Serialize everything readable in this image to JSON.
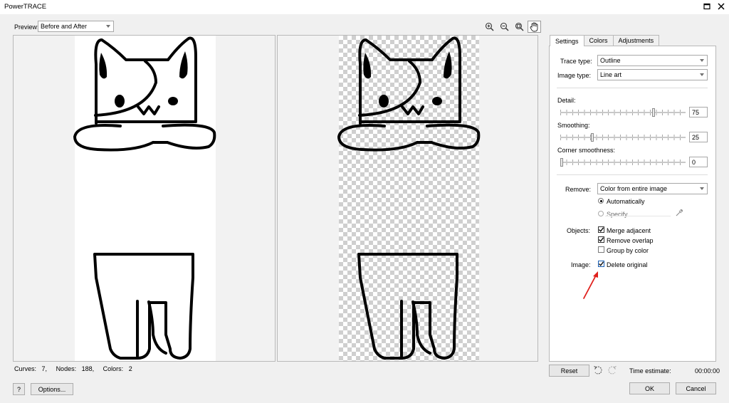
{
  "window": {
    "title": "PowerTRACE"
  },
  "preview": {
    "label": "Preview:",
    "mode": "Before and After"
  },
  "icons": {
    "maximize": "maximize-icon",
    "close": "close-icon",
    "zoom_in": "zoom-in-icon",
    "zoom_out": "zoom-out-icon",
    "zoom_fit": "zoom-fit-icon",
    "pan": "pan-hand-icon",
    "undo": "undo-icon",
    "redo": "redo-icon",
    "eyedropper": "eyedropper-icon",
    "annotation_arrow": "red-arrow-annotation"
  },
  "stats": {
    "curves_label": "Curves:",
    "curves_value": "7,",
    "nodes_label": "Nodes:",
    "nodes_value": "188,",
    "colors_label": "Colors:",
    "colors_value": "2"
  },
  "buttons": {
    "help": "?",
    "options": "Options...",
    "reset": "Reset",
    "ok": "OK",
    "cancel": "Cancel"
  },
  "time_estimate": {
    "label": "Time estimate:",
    "value": "00:00:00"
  },
  "tabs": [
    "Settings",
    "Colors",
    "Adjustments"
  ],
  "settings": {
    "trace_type_label": "Trace type:",
    "trace_type_value": "Outline",
    "image_type_label": "Image type:",
    "image_type_value": "Line art",
    "detail_label": "Detail:",
    "detail_value": "75",
    "smoothing_label": "Smoothing:",
    "smoothing_value": "25",
    "corner_label": "Corner smoothness:",
    "corner_value": "0",
    "remove_label": "Remove:",
    "remove_value": "Color from entire image",
    "automatically_label": "Automatically",
    "specify_label": "Specify",
    "objects_label": "Objects:",
    "merge_adjacent_label": "Merge adjacent",
    "remove_overlap_label": "Remove overlap",
    "group_by_color_label": "Group by color",
    "image_label": "Image:",
    "delete_original_label": "Delete original"
  },
  "state": {
    "detail_fraction": 0.75,
    "smoothing_fraction": 0.25,
    "corner_fraction": 0,
    "automatically_selected": true,
    "merge_adjacent": true,
    "remove_overlap": true,
    "group_by_color": false,
    "delete_original": true
  },
  "colors": {
    "annotation": "#e0201c",
    "accent_check": "#1a5fb4"
  }
}
